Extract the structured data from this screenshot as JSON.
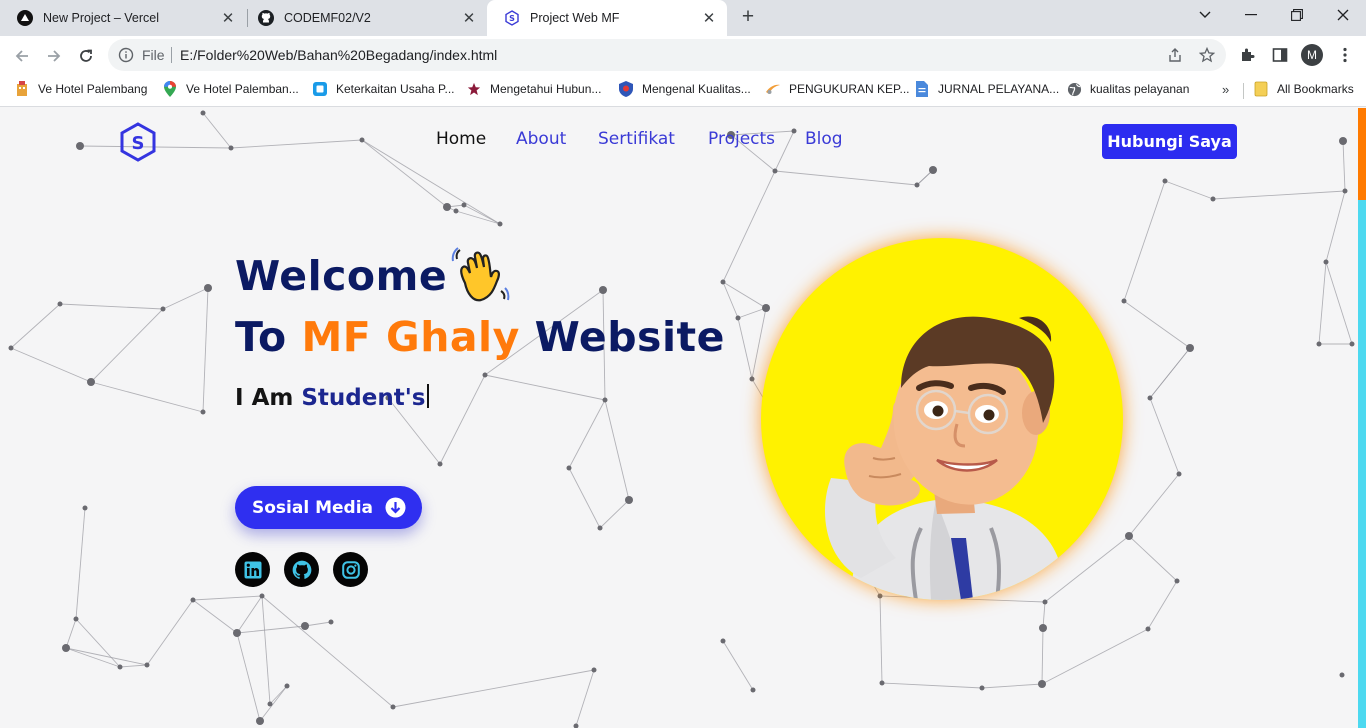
{
  "browser": {
    "tabs": [
      {
        "title": "New Project – Vercel",
        "icon": "vercel-icon"
      },
      {
        "title": "CODEMF02/V2",
        "icon": "github-icon"
      },
      {
        "title": "Project Web MF",
        "icon": "site-logo-icon"
      }
    ],
    "address": {
      "scheme_label": "File",
      "url": "E:/Folder%20Web/Bahan%20Begadang/index.html"
    },
    "profile_initial": "M",
    "bookmarks": [
      {
        "label": "Ve Hotel Palembang",
        "icon": "hotel-icon"
      },
      {
        "label": "Ve Hotel Palemban...",
        "icon": "maps-pin-icon"
      },
      {
        "label": "Keterkaitan Usaha P...",
        "icon": "doc-blue-icon"
      },
      {
        "label": "Mengetahui Hubun...",
        "icon": "star-icon"
      },
      {
        "label": "Mengenal Kualitas...",
        "icon": "shield-icon"
      },
      {
        "label": "PENGUKURAN KEP...",
        "icon": "swoosh-icon"
      },
      {
        "label": "JURNAL PELAYANA...",
        "icon": "file-icon"
      },
      {
        "label": "kualitas pelayanan",
        "icon": "globe-icon"
      }
    ],
    "bookmarks_more": "»",
    "all_bookmarks": "All Bookmarks"
  },
  "page": {
    "nav": {
      "home": "Home",
      "about": "About",
      "sertifikat": "Sertifikat",
      "projects": "Projects",
      "blog": "Blog"
    },
    "cta": "Hubungi Saya",
    "hero": {
      "line1": "Welcome",
      "line2_pre": "To ",
      "line2_accent": "MF Ghaly",
      "line2_post": " Website",
      "sub_static": "I Am ",
      "sub_typed": "Student's"
    },
    "social_button": "Sosial Media",
    "social_icons": [
      "linkedin-icon",
      "github-icon",
      "instagram-icon"
    ],
    "colors": {
      "accent": "#ff7a0b",
      "primary": "#2c2cf0",
      "heading": "#0b1a63",
      "avatar_bg": "#fff200"
    }
  }
}
